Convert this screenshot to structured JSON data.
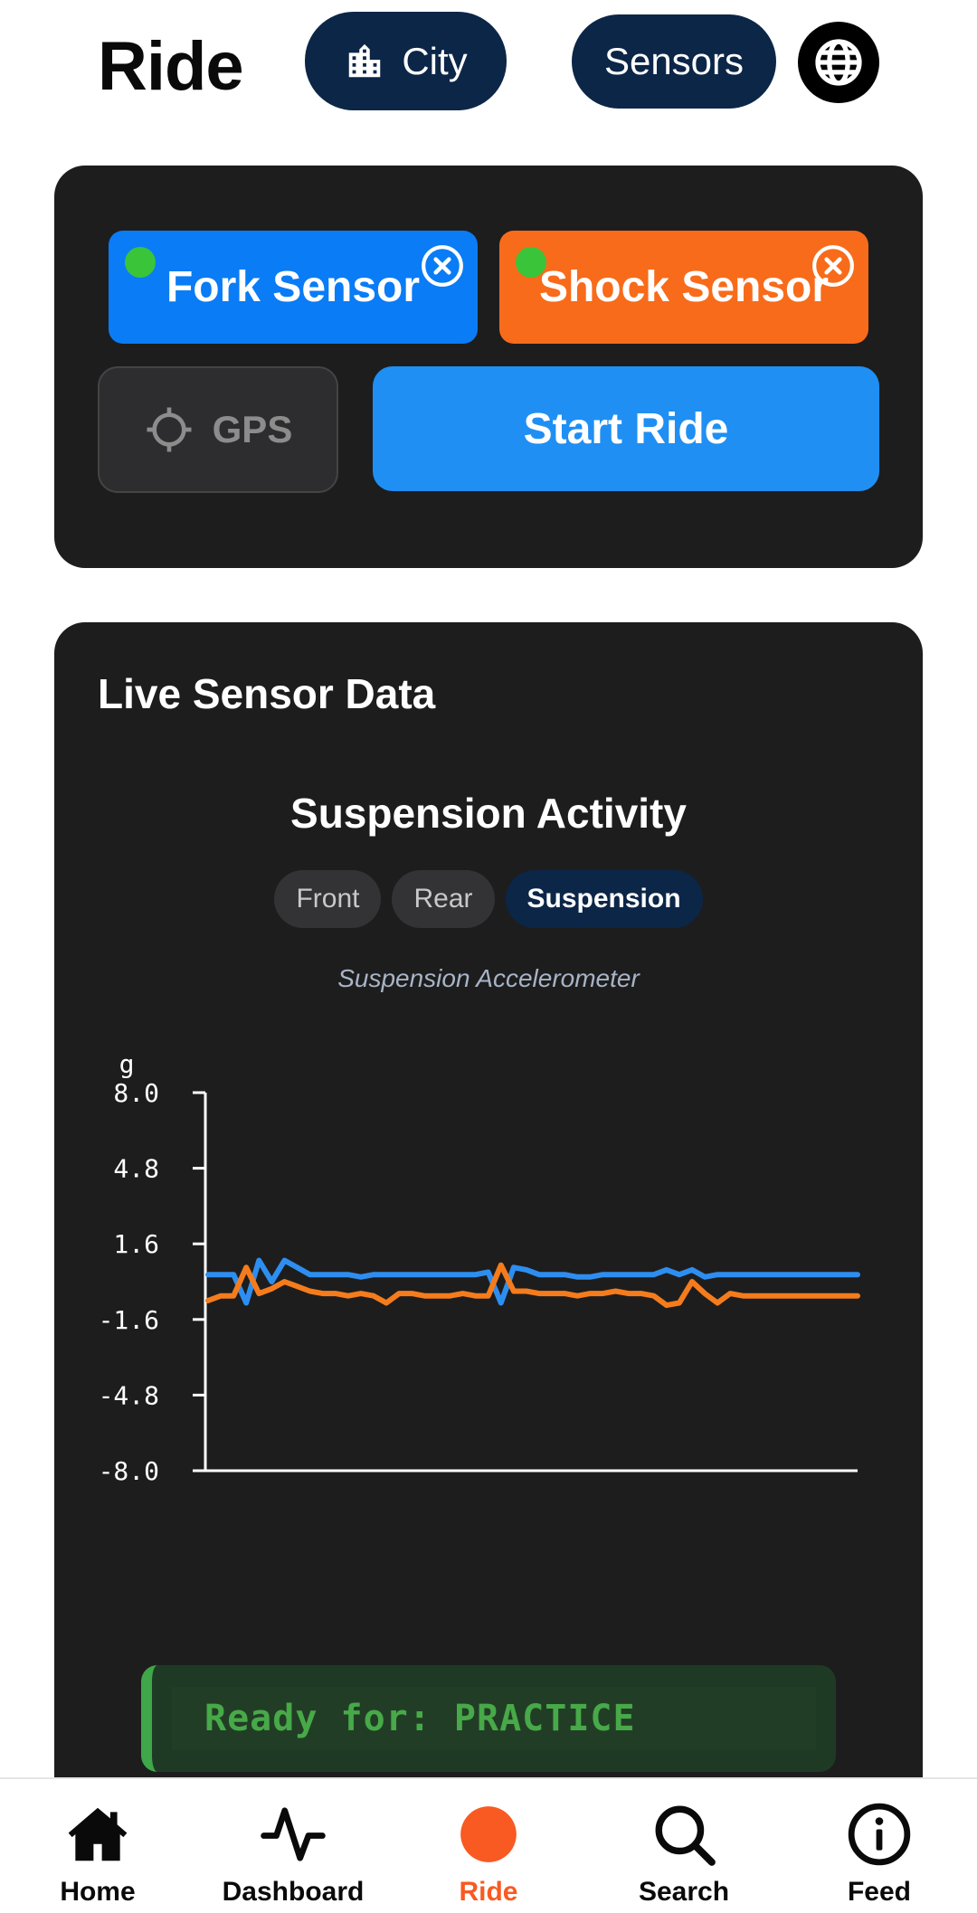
{
  "header": {
    "title": "Ride",
    "city_label": "City",
    "sensors_label": "Sensors"
  },
  "controls": {
    "fork_sensor": {
      "label": "Fork Sensor",
      "status": "connected"
    },
    "shock_sensor": {
      "label": "Shock Sensor",
      "status": "connected"
    },
    "gps_label": "GPS",
    "start_ride_label": "Start Ride"
  },
  "live": {
    "title": "Live Sensor Data",
    "chart_title": "Suspension Activity",
    "tabs": [
      {
        "label": "Front",
        "active": false
      },
      {
        "label": "Rear",
        "active": false
      },
      {
        "label": "Suspension",
        "active": true
      }
    ],
    "chart_subtitle": "Suspension Accelerometer",
    "ready_text": "Ready for: PRACTICE"
  },
  "chart_data": {
    "type": "line",
    "ylabel": "g",
    "ylim": [
      -8.0,
      8.0
    ],
    "yticks": [
      "8.0",
      "4.8",
      "1.6",
      "-1.6",
      "-4.8",
      "-8.0"
    ],
    "grid": false,
    "series": [
      {
        "color": "#2e8ef0",
        "values": [
          0.3,
          0.3,
          0.3,
          -0.9,
          0.9,
          0.0,
          0.9,
          0.6,
          0.3,
          0.3,
          0.3,
          0.3,
          0.2,
          0.3,
          0.3,
          0.3,
          0.3,
          0.3,
          0.3,
          0.3,
          0.3,
          0.3,
          0.4,
          -0.9,
          0.6,
          0.5,
          0.3,
          0.3,
          0.3,
          0.2,
          0.2,
          0.3,
          0.3,
          0.3,
          0.3,
          0.3,
          0.5,
          0.3,
          0.5,
          0.2,
          0.3,
          0.3,
          0.3,
          0.3,
          0.3,
          0.3,
          0.3,
          0.3,
          0.3,
          0.3,
          0.3,
          0.3
        ]
      },
      {
        "color": "#f57c1c",
        "values": [
          -0.8,
          -0.6,
          -0.6,
          0.6,
          -0.5,
          -0.3,
          0.0,
          -0.2,
          -0.4,
          -0.5,
          -0.5,
          -0.6,
          -0.5,
          -0.6,
          -0.9,
          -0.5,
          -0.5,
          -0.6,
          -0.6,
          -0.6,
          -0.5,
          -0.6,
          -0.6,
          0.7,
          -0.4,
          -0.4,
          -0.5,
          -0.5,
          -0.5,
          -0.6,
          -0.5,
          -0.5,
          -0.4,
          -0.5,
          -0.5,
          -0.6,
          -1.0,
          -0.9,
          0.0,
          -0.5,
          -0.9,
          -0.5,
          -0.6,
          -0.6,
          -0.6,
          -0.6,
          -0.6,
          -0.6,
          -0.6,
          -0.6,
          -0.6,
          -0.6
        ]
      }
    ]
  },
  "nav": {
    "items": [
      {
        "label": "Home",
        "icon": "home-icon"
      },
      {
        "label": "Dashboard",
        "icon": "pulse-icon"
      },
      {
        "label": "Ride",
        "icon": "record-icon",
        "active": true
      },
      {
        "label": "Search",
        "icon": "search-icon"
      },
      {
        "label": "Feed",
        "icon": "info-icon"
      }
    ]
  },
  "colors": {
    "accent_orange": "#f85a22",
    "navy": "#0c2648",
    "card": "#1d1d1e",
    "ready_green": "#47a948"
  }
}
